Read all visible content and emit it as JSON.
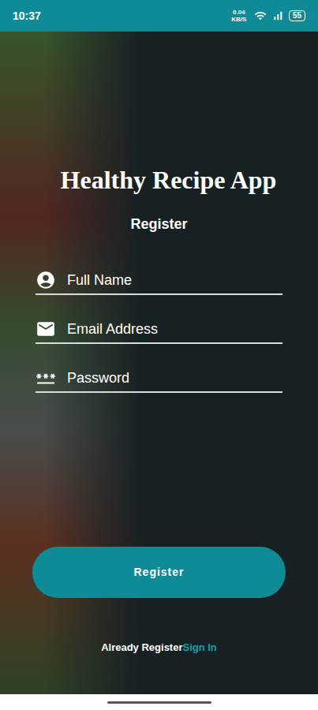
{
  "status_bar": {
    "time": "10:37",
    "network_speed": "0.04 KB/S",
    "battery": "55"
  },
  "app": {
    "title": "Healthy Recipe App",
    "heading": "Register"
  },
  "fields": [
    {
      "placeholder": "Full Name",
      "kind": "name"
    },
    {
      "placeholder": "Email Address",
      "kind": "email"
    },
    {
      "placeholder": "Password",
      "kind": "password"
    }
  ],
  "button": "Register",
  "footer": {
    "prompt": "Already Register",
    "link": "Sign In"
  }
}
